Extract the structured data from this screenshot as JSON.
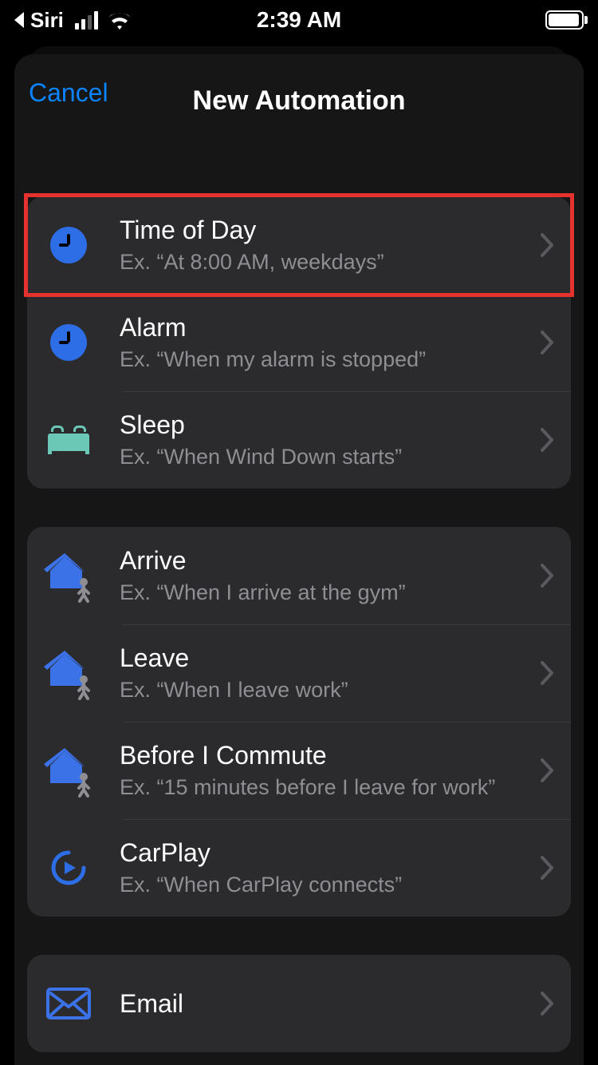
{
  "status_bar": {
    "back_app": "Siri",
    "time": "2:39 AM"
  },
  "sheet": {
    "cancel_label": "Cancel",
    "title": "New Automation"
  },
  "groups": [
    {
      "rows": [
        {
          "icon": "clock-icon",
          "title": "Time of Day",
          "subtitle": "Ex. “At 8:00 AM, weekdays”",
          "highlighted": true
        },
        {
          "icon": "clock-icon",
          "title": "Alarm",
          "subtitle": "Ex. “When my alarm is stopped”"
        },
        {
          "icon": "bed-icon",
          "title": "Sleep",
          "subtitle": "Ex. “When Wind Down starts”"
        }
      ]
    },
    {
      "rows": [
        {
          "icon": "house-person-icon",
          "title": "Arrive",
          "subtitle": "Ex. “When I arrive at the gym”"
        },
        {
          "icon": "house-person-icon",
          "title": "Leave",
          "subtitle": "Ex. “When I leave work”"
        },
        {
          "icon": "house-person-icon",
          "title": "Before I Commute",
          "subtitle": "Ex. “15 minutes before I leave for work”"
        },
        {
          "icon": "carplay-icon",
          "title": "CarPlay",
          "subtitle": "Ex. “When CarPlay connects”"
        }
      ]
    },
    {
      "rows": [
        {
          "icon": "mail-icon",
          "title": "Email",
          "subtitle": ""
        }
      ]
    }
  ],
  "colors": {
    "accent_blue": "#2d6ee6",
    "link_blue": "#0a84ff",
    "sleep_teal": "#6bc8b7",
    "highlight_red": "#e5322f"
  }
}
